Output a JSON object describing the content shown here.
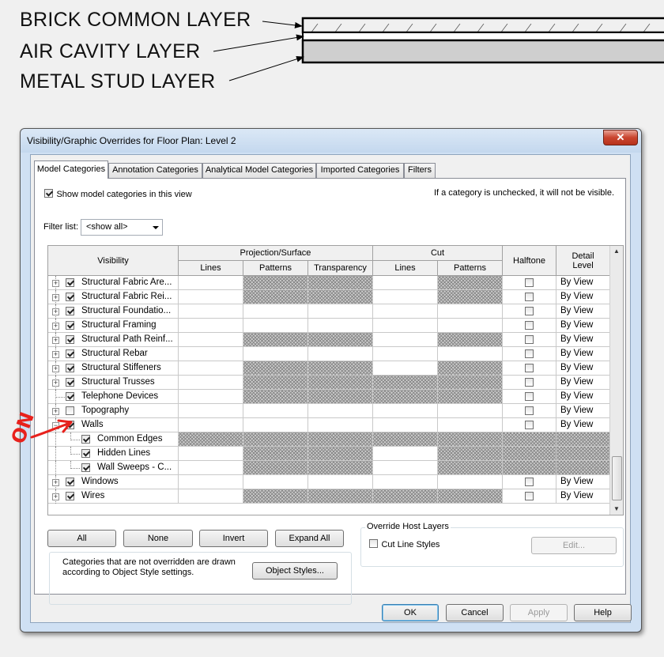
{
  "diagram": {
    "labels": [
      "BRICK COMMON LAYER",
      "AIR CAVITY LAYER",
      "METAL STUD LAYER"
    ]
  },
  "annotation": {
    "text": "ON"
  },
  "dialog": {
    "title": "Visibility/Graphic Overrides for Floor Plan: Level 2",
    "close_glyph": "✕",
    "tabs": [
      "Model Categories",
      "Annotation Categories",
      "Analytical Model Categories",
      "Imported Categories",
      "Filters"
    ],
    "active_tab": 0,
    "show_model_categories": {
      "label": "Show model categories in this view",
      "checked": true
    },
    "hint": "If a category is unchecked, it will not be visible.",
    "filter_list": {
      "label": "Filter list:",
      "value": "<show all>"
    },
    "grid": {
      "headers": {
        "visibility": "Visibility",
        "projection_surface": "Projection/Surface",
        "cut": "Cut",
        "halftone": "Halftone",
        "detail_level": "Detail Level",
        "proj_lines": "Lines",
        "proj_patterns": "Patterns",
        "proj_transparency": "Transparency",
        "cut_lines": "Lines",
        "cut_patterns": "Patterns"
      },
      "rows": [
        {
          "label": "Structural Fabric Are...",
          "level": 0,
          "expander": "+",
          "checked": true,
          "hatch": [
            false,
            true,
            true,
            false,
            true
          ],
          "halftone_on": false,
          "detail": "By View"
        },
        {
          "label": "Structural Fabric Rei...",
          "level": 0,
          "expander": "+",
          "checked": true,
          "hatch": [
            false,
            true,
            true,
            false,
            true
          ],
          "halftone_on": false,
          "detail": "By View"
        },
        {
          "label": "Structural Foundatio...",
          "level": 0,
          "expander": "+",
          "checked": true,
          "hatch": [
            false,
            false,
            false,
            false,
            false
          ],
          "halftone_on": false,
          "detail": "By View"
        },
        {
          "label": "Structural Framing",
          "level": 0,
          "expander": "+",
          "checked": true,
          "hatch": [
            false,
            false,
            false,
            false,
            false
          ],
          "halftone_on": false,
          "detail": "By View"
        },
        {
          "label": "Structural Path Reinf...",
          "level": 0,
          "expander": "+",
          "checked": true,
          "hatch": [
            false,
            true,
            true,
            false,
            true
          ],
          "halftone_on": false,
          "detail": "By View"
        },
        {
          "label": "Structural Rebar",
          "level": 0,
          "expander": "+",
          "checked": true,
          "hatch": [
            false,
            false,
            false,
            false,
            false
          ],
          "halftone_on": false,
          "detail": "By View"
        },
        {
          "label": "Structural Stiffeners",
          "level": 0,
          "expander": "+",
          "checked": true,
          "hatch": [
            false,
            true,
            true,
            false,
            true
          ],
          "halftone_on": false,
          "detail": "By View"
        },
        {
          "label": "Structural Trusses",
          "level": 0,
          "expander": "+",
          "checked": true,
          "hatch": [
            false,
            true,
            true,
            true,
            true
          ],
          "halftone_on": false,
          "detail": "By View"
        },
        {
          "label": "Telephone Devices",
          "level": 0,
          "expander": "",
          "checked": true,
          "hatch": [
            false,
            true,
            true,
            true,
            true
          ],
          "halftone_on": false,
          "detail": "By View"
        },
        {
          "label": "Topography",
          "level": 0,
          "expander": "+",
          "checked": false,
          "hatch": [
            false,
            false,
            false,
            false,
            false
          ],
          "halftone_on": false,
          "detail": "By View"
        },
        {
          "label": "Walls",
          "level": 0,
          "expander": "−",
          "checked": true,
          "hatch": [
            false,
            false,
            false,
            false,
            false
          ],
          "halftone_on": false,
          "detail": "By View"
        },
        {
          "label": "Common Edges",
          "level": 1,
          "expander": "",
          "checked": true,
          "hatch": [
            true,
            true,
            true,
            true,
            true
          ],
          "halftone_on": null,
          "detail": ""
        },
        {
          "label": "Hidden Lines",
          "level": 1,
          "expander": "",
          "checked": true,
          "hatch": [
            false,
            true,
            true,
            false,
            true
          ],
          "halftone_on": null,
          "detail": ""
        },
        {
          "label": "Wall Sweeps - C...",
          "level": 1,
          "expander": "",
          "checked": true,
          "hatch": [
            false,
            true,
            true,
            false,
            true
          ],
          "halftone_on": null,
          "detail": ""
        },
        {
          "label": "Windows",
          "level": 0,
          "expander": "+",
          "checked": true,
          "hatch": [
            false,
            false,
            false,
            false,
            false
          ],
          "halftone_on": false,
          "detail": "By View"
        },
        {
          "label": "Wires",
          "level": 0,
          "expander": "+",
          "checked": true,
          "hatch": [
            false,
            true,
            true,
            true,
            true
          ],
          "halftone_on": false,
          "detail": "By View"
        }
      ]
    },
    "buttons": {
      "all": "All",
      "none": "None",
      "invert": "Invert",
      "expand_all": "Expand All",
      "object_styles": "Object Styles...",
      "edit": "Edit...",
      "ok": "OK",
      "cancel": "Cancel",
      "apply": "Apply",
      "help": "Help"
    },
    "note": "Categories that are not overridden are drawn according to Object Style settings.",
    "override_host_layers": {
      "title": "Override Host Layers",
      "cut_line_styles": {
        "label": "Cut Line Styles",
        "checked": false
      }
    }
  }
}
